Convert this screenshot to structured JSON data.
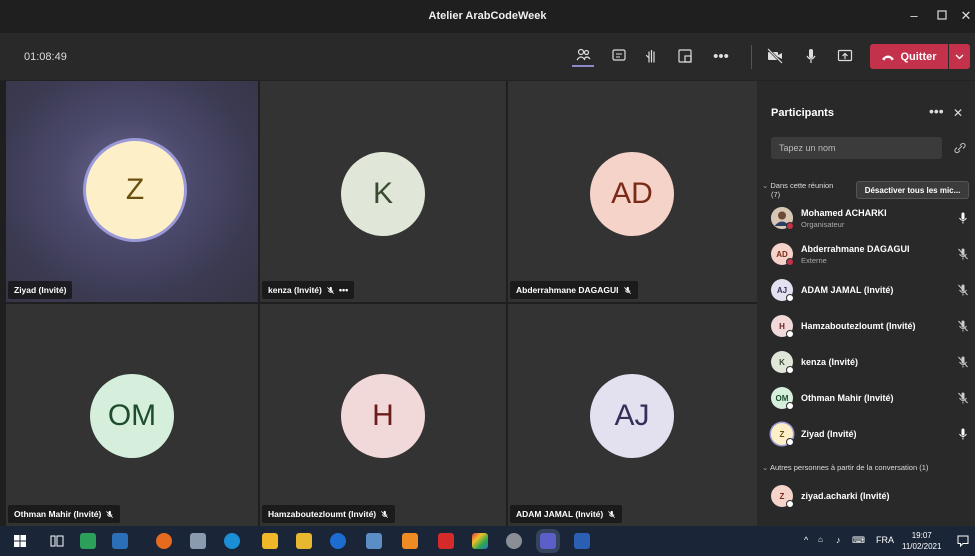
{
  "window": {
    "title": "Atelier ArabCodeWeek"
  },
  "toolbar": {
    "timer": "01:08:49",
    "leave_label": "Quitter"
  },
  "tiles": [
    {
      "initials": "Z",
      "name": "Ziyad (Invité)"
    },
    {
      "initials": "K",
      "name": "kenza (Invité)"
    },
    {
      "initials": "AD",
      "name": "Abderrahmane DAGAGUI"
    },
    {
      "initials": "OM",
      "name": "Othman Mahir (Invité)"
    },
    {
      "initials": "H",
      "name": "Hamzaboutezloumt (Invité)"
    },
    {
      "initials": "AJ",
      "name": "ADAM JAMAL (Invité)"
    }
  ],
  "colors": {
    "avatar_z": "#fdf0c8",
    "avatar_k": "#e0e6d8",
    "avatar_ad": "#f6d3c9",
    "avatar_om": "#d6efdc",
    "avatar_h": "#f2d9d9",
    "avatar_aj": "#e3e1f0",
    "leave": "#c4314b",
    "accent": "#8b8cc7"
  },
  "panel": {
    "title": "Participants",
    "search_placeholder": "Tapez un nom",
    "in_meeting_label": "Dans cette réunion",
    "in_meeting_count": "(7)",
    "mute_all_label": "Désactiver tous les mic...",
    "others_label": "Autres personnes à partir de la conversation (1)",
    "participants": [
      {
        "initials": "",
        "name": "Mohamed ACHARKI",
        "role": "Organisateur"
      },
      {
        "initials": "AD",
        "name": "Abderrahmane DAGAGUI",
        "role": "Externe"
      },
      {
        "initials": "AJ",
        "name": "ADAM JAMAL (Invité)"
      },
      {
        "initials": "H",
        "name": "Hamzaboutezloumt (Invité)"
      },
      {
        "initials": "K",
        "name": "kenza (Invité)"
      },
      {
        "initials": "OM",
        "name": "Othman Mahir (Invité)"
      },
      {
        "initials": "Z",
        "name": "Ziyad (Invité)"
      }
    ],
    "others": [
      {
        "initials": "Z",
        "name": "ziyad.acharki (Invité)"
      }
    ]
  },
  "taskbar": {
    "language": "FRA",
    "time": "19:07",
    "date": "11/02/2021"
  }
}
